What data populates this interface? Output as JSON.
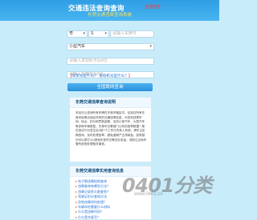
{
  "header": {
    "title": "交通违法查询查询",
    "title_tag": "全国通查",
    "subtitle": "东莞交通违章查询系统"
  },
  "form": {
    "province_value": "粤",
    "letter_value": "S",
    "plate_placeholder": "请输入车牌号",
    "vehicle_type_value": "小型汽车",
    "engine_placeholder": "请输入发动机号后6位",
    "vin_placeholder": "请输入车架号后6位",
    "help_prefix": "【",
    "help_link_1": "车架号是什么？",
    "help_link_2": "发动机号是什么？",
    "help_suffix": "】",
    "submit_label": "全国联网查询"
  },
  "card1": {
    "title": "东莞交通违章查询说明",
    "body": "本站可以查询所有车牌在东莞市辖区内，包括在所有东莞本地周边地区所有的交通违章信息，可查到违章时间、地点、扣分和罚款金额，支持小型汽车、大型汽车等多种车辆类型。东莞市交警部门公布的违章数据一般在违法行为发生后3到7个工作日内录入系统，请车主定期查询，及时处理违章，避免逾期产生滞纳金。如有疑问可以拨打114咨询东莞市交警支队电话，或前往当地车管所咨询处理相关事宜。"
  },
  "card2": {
    "title": "东莞交通违章实用查询信息",
    "items": [
      "电子眼违章拍照查询",
      "违章查询有哪些方法？",
      "违章记录多久能查到？",
      "驾驶证扣分查询方法",
      "异地违章如何处理？",
      "车辆年检需要什么材料",
      "什么是违章代码？",
      "什么是车架号？"
    ]
  },
  "watermark": {
    "text": "0401分类",
    "sub": "www.0401.cn"
  }
}
